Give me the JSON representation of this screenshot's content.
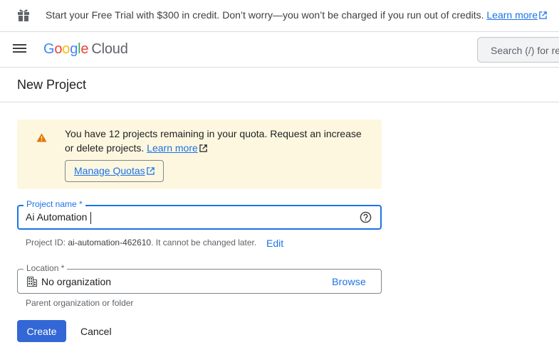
{
  "banner": {
    "text": "Start your Free Trial with $300 in credit. Don’t worry—you won’t be charged if you run out of credits. ",
    "link": "Learn more"
  },
  "header": {
    "logo_google": [
      "G",
      "o",
      "o",
      "g",
      "l",
      "e"
    ],
    "logo_google_colors": [
      "#4285f4",
      "#ea4335",
      "#fbbc05",
      "#4285f4",
      "#34a853",
      "#ea4335"
    ],
    "logo_cloud": "Cloud",
    "search_placeholder": "Search (/) for re"
  },
  "page": {
    "title": "New Project"
  },
  "notice": {
    "text": "You have 12 projects remaining in your quota. Request an increase or delete projects. ",
    "link": "Learn more",
    "button": "Manage Quotas"
  },
  "form": {
    "project_name": {
      "label": "Project name *",
      "value": "Ai Automation"
    },
    "project_id": {
      "prefix": "Project ID: ",
      "id": "ai-automation-462610",
      "suffix": ". It cannot be changed later.",
      "edit": "Edit"
    },
    "location": {
      "label": "Location *",
      "value": "No organization",
      "browse": "Browse",
      "help": "Parent organization or folder"
    }
  },
  "actions": {
    "create": "Create",
    "cancel": "Cancel"
  },
  "colors": {
    "primary": "#1a73e8",
    "create_bg": "#3367d6",
    "warning": "#e37400",
    "notice_bg": "#fef7e0"
  }
}
